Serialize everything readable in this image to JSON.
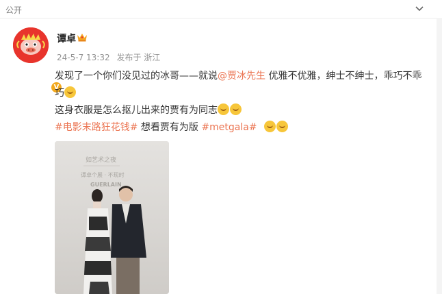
{
  "header": {
    "visibility": "公开",
    "expand_icon": "chevron-down-icon"
  },
  "user": {
    "name": "谭卓",
    "avatar_icon": "dragon-avatar",
    "badge_icon": "crown-icon",
    "verified_mark": "V"
  },
  "post_meta": {
    "time": "24-5-7 13:32",
    "source": "发布于 浙江"
  },
  "post": {
    "line1_a": "发现了一个你们没见过的冰哥——就说",
    "mention": "@贾冰先生",
    "line1_b": " 优雅不优雅，绅士不绅士，乖巧不乖巧",
    "line2": "这身衣服是怎么抠儿出来的贾有为同志",
    "hashtag1": "#电影末路狂花钱#",
    "line3_mid": " 想看贾有为版 ",
    "hashtag2": "#metgala#"
  },
  "photo": {
    "backdrop_text_1": "如艺术之夜",
    "backdrop_text_2": "谭卓个展 · 不现时",
    "backdrop_text_3": "GUERLAIN"
  },
  "colors": {
    "link": "#eb7350",
    "text": "#333333",
    "meta": "#939393",
    "avatar": "#e8342c"
  }
}
